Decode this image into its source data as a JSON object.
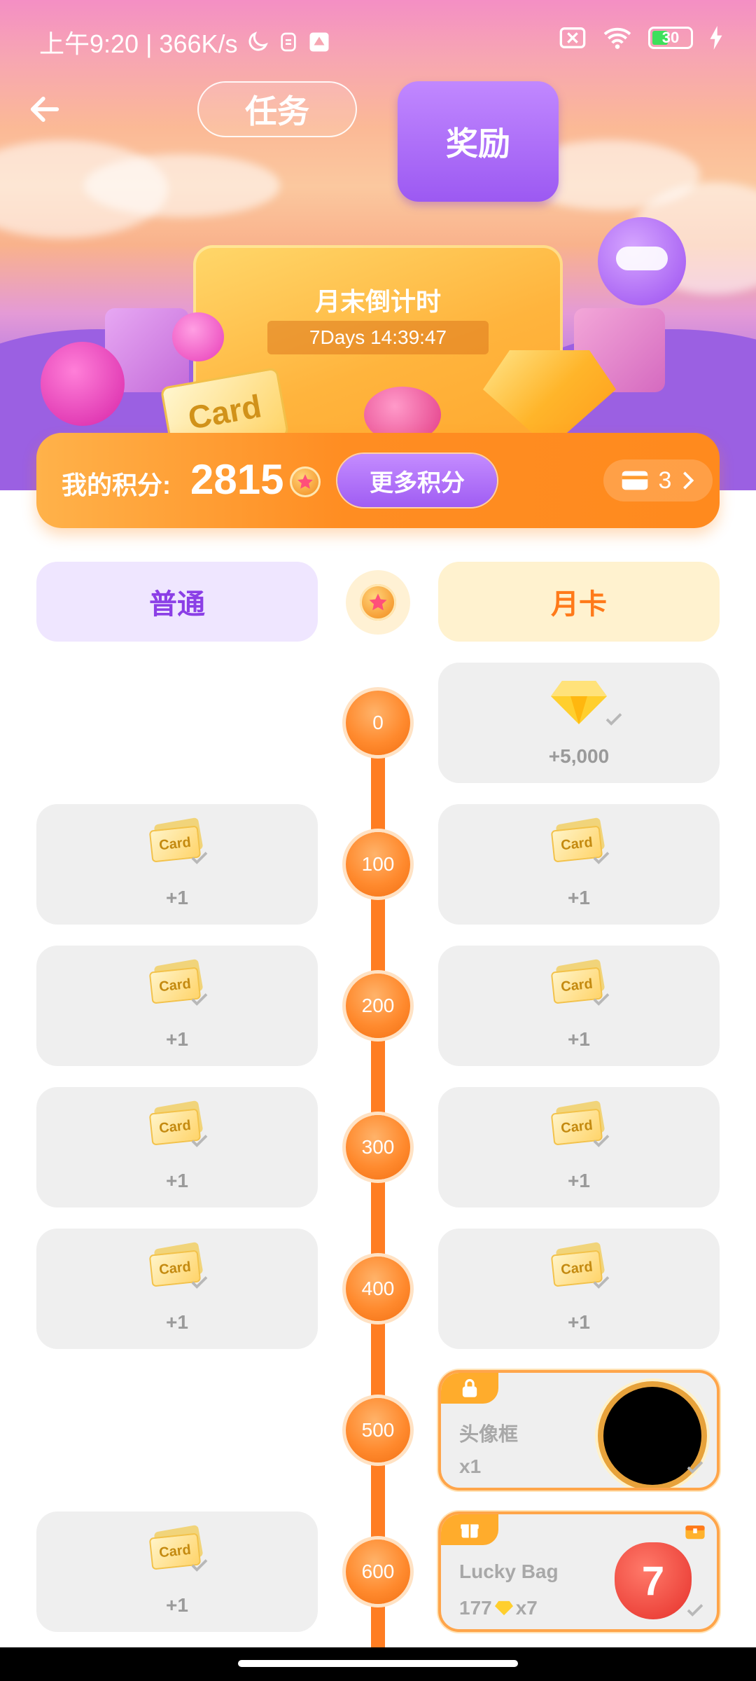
{
  "status_bar": {
    "time_speed": "上午9:20 | 366K/s",
    "battery": "30",
    "icons": [
      "moon-icon",
      "notification-icon",
      "app-icon",
      "sim-off-icon",
      "wifi-icon",
      "battery-icon",
      "charging-icon"
    ]
  },
  "header": {
    "back_icon": "back-arrow-icon",
    "tabs": [
      {
        "label": "任务",
        "active": false
      },
      {
        "label": "奖励",
        "active": true
      }
    ]
  },
  "banner": {
    "countdown_title": "月末倒计时",
    "countdown_time": "7Days 14:39:47",
    "card_word": "Card"
  },
  "points": {
    "label": "我的积分:",
    "value": "2815",
    "more_button": "更多积分",
    "card_count": "3"
  },
  "columns": {
    "normal": "普通",
    "monthly": "月卡"
  },
  "levels": [
    {
      "threshold": "0",
      "normal": null,
      "monthly": {
        "icon": "diamond-icon",
        "amount": "+5,000"
      }
    },
    {
      "threshold": "100",
      "normal": {
        "icon": "card-icon",
        "label": "Card",
        "amount": "+1"
      },
      "monthly": {
        "icon": "card-icon",
        "label": "Card",
        "amount": "+1"
      }
    },
    {
      "threshold": "200",
      "normal": {
        "icon": "card-icon",
        "label": "Card",
        "amount": "+1"
      },
      "monthly": {
        "icon": "card-icon",
        "label": "Card",
        "amount": "+1"
      }
    },
    {
      "threshold": "300",
      "normal": {
        "icon": "card-icon",
        "label": "Card",
        "amount": "+1"
      },
      "monthly": {
        "icon": "card-icon",
        "label": "Card",
        "amount": "+1"
      }
    },
    {
      "threshold": "400",
      "normal": {
        "icon": "card-icon",
        "label": "Card",
        "amount": "+1"
      },
      "monthly": {
        "icon": "card-icon",
        "label": "Card",
        "amount": "+1"
      }
    },
    {
      "threshold": "500",
      "normal": null,
      "monthly": {
        "icon": "avatar-frame-icon",
        "name": "头像框",
        "qty": "x1"
      }
    },
    {
      "threshold": "600",
      "normal": {
        "icon": "card-icon",
        "label": "Card",
        "amount": "+1"
      },
      "monthly": {
        "icon": "lucky-bag-icon",
        "name": "Lucky Bag",
        "qty_prefix": "177",
        "qty_suffix": "x7",
        "bag_number": "7"
      }
    }
  ],
  "colors": {
    "accent_orange": "#ff7d22",
    "accent_purple": "#a05df3",
    "normal_text": "#8b3fe6",
    "monthly_text": "#ff7a1a"
  }
}
